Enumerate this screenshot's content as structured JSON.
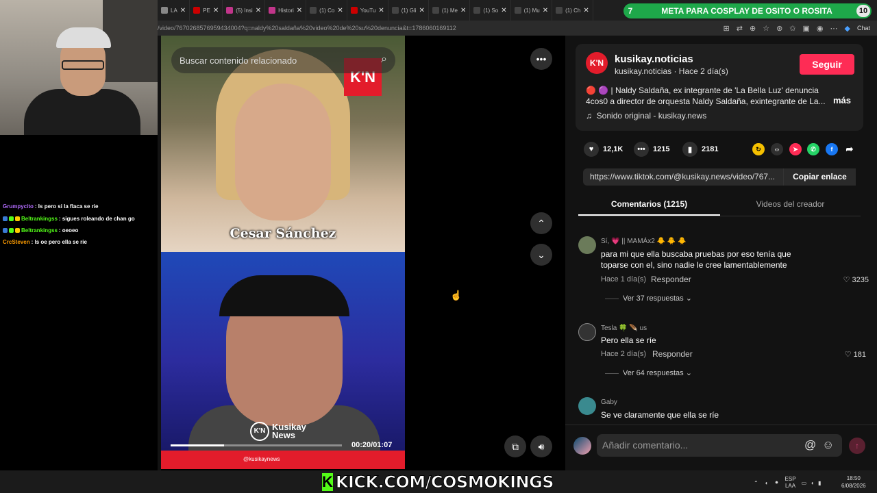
{
  "browser": {
    "tabs": [
      {
        "label": "LA",
        "color": "#888"
      },
      {
        "label": "PE",
        "color": "#c00"
      },
      {
        "label": "(5) Insi",
        "color": "#c1358a"
      },
      {
        "label": "Histori",
        "color": "#c1358a"
      },
      {
        "label": "(1) Co",
        "color": "#999"
      },
      {
        "label": "YouTu",
        "color": "#c00"
      },
      {
        "label": "(1) Gli",
        "color": "#999"
      },
      {
        "label": "(1) Me",
        "color": "#999"
      },
      {
        "label": "(1) So",
        "color": "#999"
      },
      {
        "label": "(1) Mu",
        "color": "#999"
      },
      {
        "label": "(1) Ch",
        "color": "#999"
      }
    ],
    "url": "/video/7670268576959434004?q=naldy%20saldaña%20video%20de%20su%20denuncia&t=1786060169112",
    "chat_label": "Chat"
  },
  "stream_banner": {
    "left_number": "7",
    "text": "META PARA COSPLAY DE OSITO O ROSITA",
    "right_number": "10",
    "color": "#1ea84a"
  },
  "stream_chat": [
    {
      "user": "Grumpycito",
      "message": ": ls pero si la flaca se rie",
      "color": "#b36cff"
    },
    {
      "user": "Beltrankingss",
      "message": ": sigues roleando de chan go",
      "color": "#53fc18"
    },
    {
      "user": "Beltrankingss",
      "message": ": oeoeo",
      "color": "#53fc18"
    },
    {
      "user": "CrcSteven",
      "message": ": ls oe pero ella se rie",
      "color": "#ff9d00"
    }
  ],
  "video": {
    "search_placeholder": "Buscar contenido relacionado",
    "logo": "K'N",
    "caption_name": "Cesar Sánchez",
    "watermark_small": "K'N",
    "watermark": "Kusikay News",
    "bar_handle": "@kusikaynews",
    "timecode": "00:20/01:07",
    "progress": 0.31
  },
  "post": {
    "avatar": "K'N",
    "account_name": "kusikay.noticias",
    "account_sub": "kusikay.noticias · Hace 2 día(s)",
    "follow_label": "Seguir",
    "description": "🔴 🟣 | Naldy Saldaña, ex integrante de 'La Bella Luz' denuncia 4cos0 a director de orquesta Naldy Saldaña, exintegrante de La...",
    "more_label": "más",
    "sound": "Sonido original - kusikay.news",
    "likes": "12,1K",
    "comments": "1215",
    "saves": "2181",
    "share_link": "https://www.tiktok.com/@kusikay.news/video/767...",
    "copy_label": "Copiar enlace"
  },
  "tabs": {
    "comments": "Comentarios (1215)",
    "creator_videos": "Videos del creador"
  },
  "comments": [
    {
      "user": "Sí, 💗 || MAMÁx2 🐥 🐥 🐥",
      "text": "para mi que ella buscaba pruebas por eso tenía que toparse con el, sino nadie le cree lamentablemente",
      "time": "Hace 1 día(s)",
      "reply": "Responder",
      "likes": "3235",
      "replies": "Ver 37 respuestas",
      "avatar_color": "#6b7b5a"
    },
    {
      "user": "Tesla 🍀 🪶 us",
      "text": "Pero ella se ríe",
      "time": "Hace 2 día(s)",
      "reply": "Responder",
      "likes": "181",
      "replies": "Ver 64 respuestas",
      "avatar_color": "#333333"
    },
    {
      "user": "Gaby",
      "text": "Se ve claramente que ella se ríe",
      "avatar_color": "#3a8a8f"
    }
  ],
  "comment_input": {
    "placeholder": "Añadir comentario..."
  },
  "taskbar": {
    "kick_text": "KICK.COM/COSMOKINGS",
    "kick_letter": "K",
    "lang_top": "ESP",
    "lang_bottom": "LAA",
    "time": "18:50",
    "date": "6/08/2026"
  },
  "colors": {
    "accent_pink": "#fe2c55",
    "kick_green": "#53fc18",
    "news_red": "#e31c2b"
  }
}
